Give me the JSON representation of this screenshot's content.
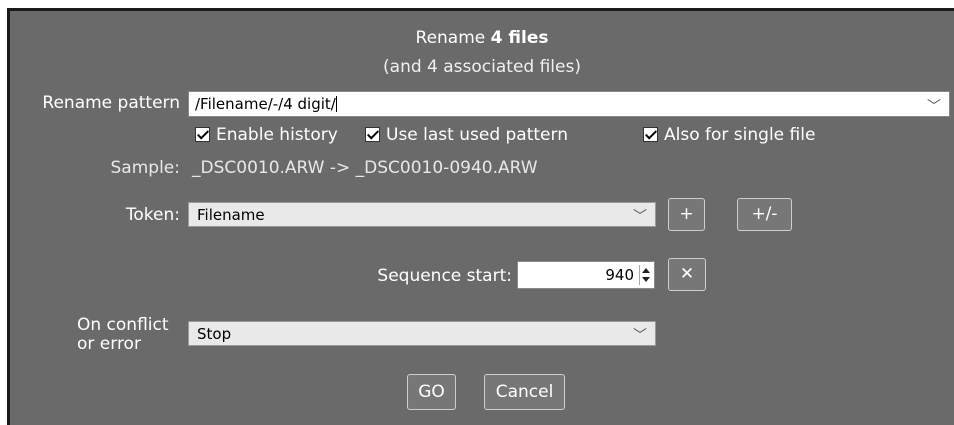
{
  "header": {
    "title_prefix": "Rename ",
    "title_bold": "4 files",
    "subtitle": "(and 4 associated files)"
  },
  "pattern": {
    "label": "Rename pattern",
    "value": "/Filename/-/4 digit/"
  },
  "options": {
    "enable_history": {
      "label": "Enable history",
      "checked": true
    },
    "use_last_pattern": {
      "label": "Use last used pattern",
      "checked": true
    },
    "single_file": {
      "label": "Also for single file",
      "checked": true
    }
  },
  "sample": {
    "label": "Sample:",
    "text": "_DSC0010.ARW -> _DSC0010-0940.ARW"
  },
  "token": {
    "label": "Token:",
    "value": "Filename",
    "add_label": "+",
    "plusminus_label": "+/-"
  },
  "sequence": {
    "label": "Sequence start:",
    "value": "940",
    "clear_label": "✕"
  },
  "conflict": {
    "label_line1": "On conflict",
    "label_line2": "or error",
    "value": "Stop"
  },
  "actions": {
    "go_label": "GO",
    "cancel_label": "Cancel"
  }
}
